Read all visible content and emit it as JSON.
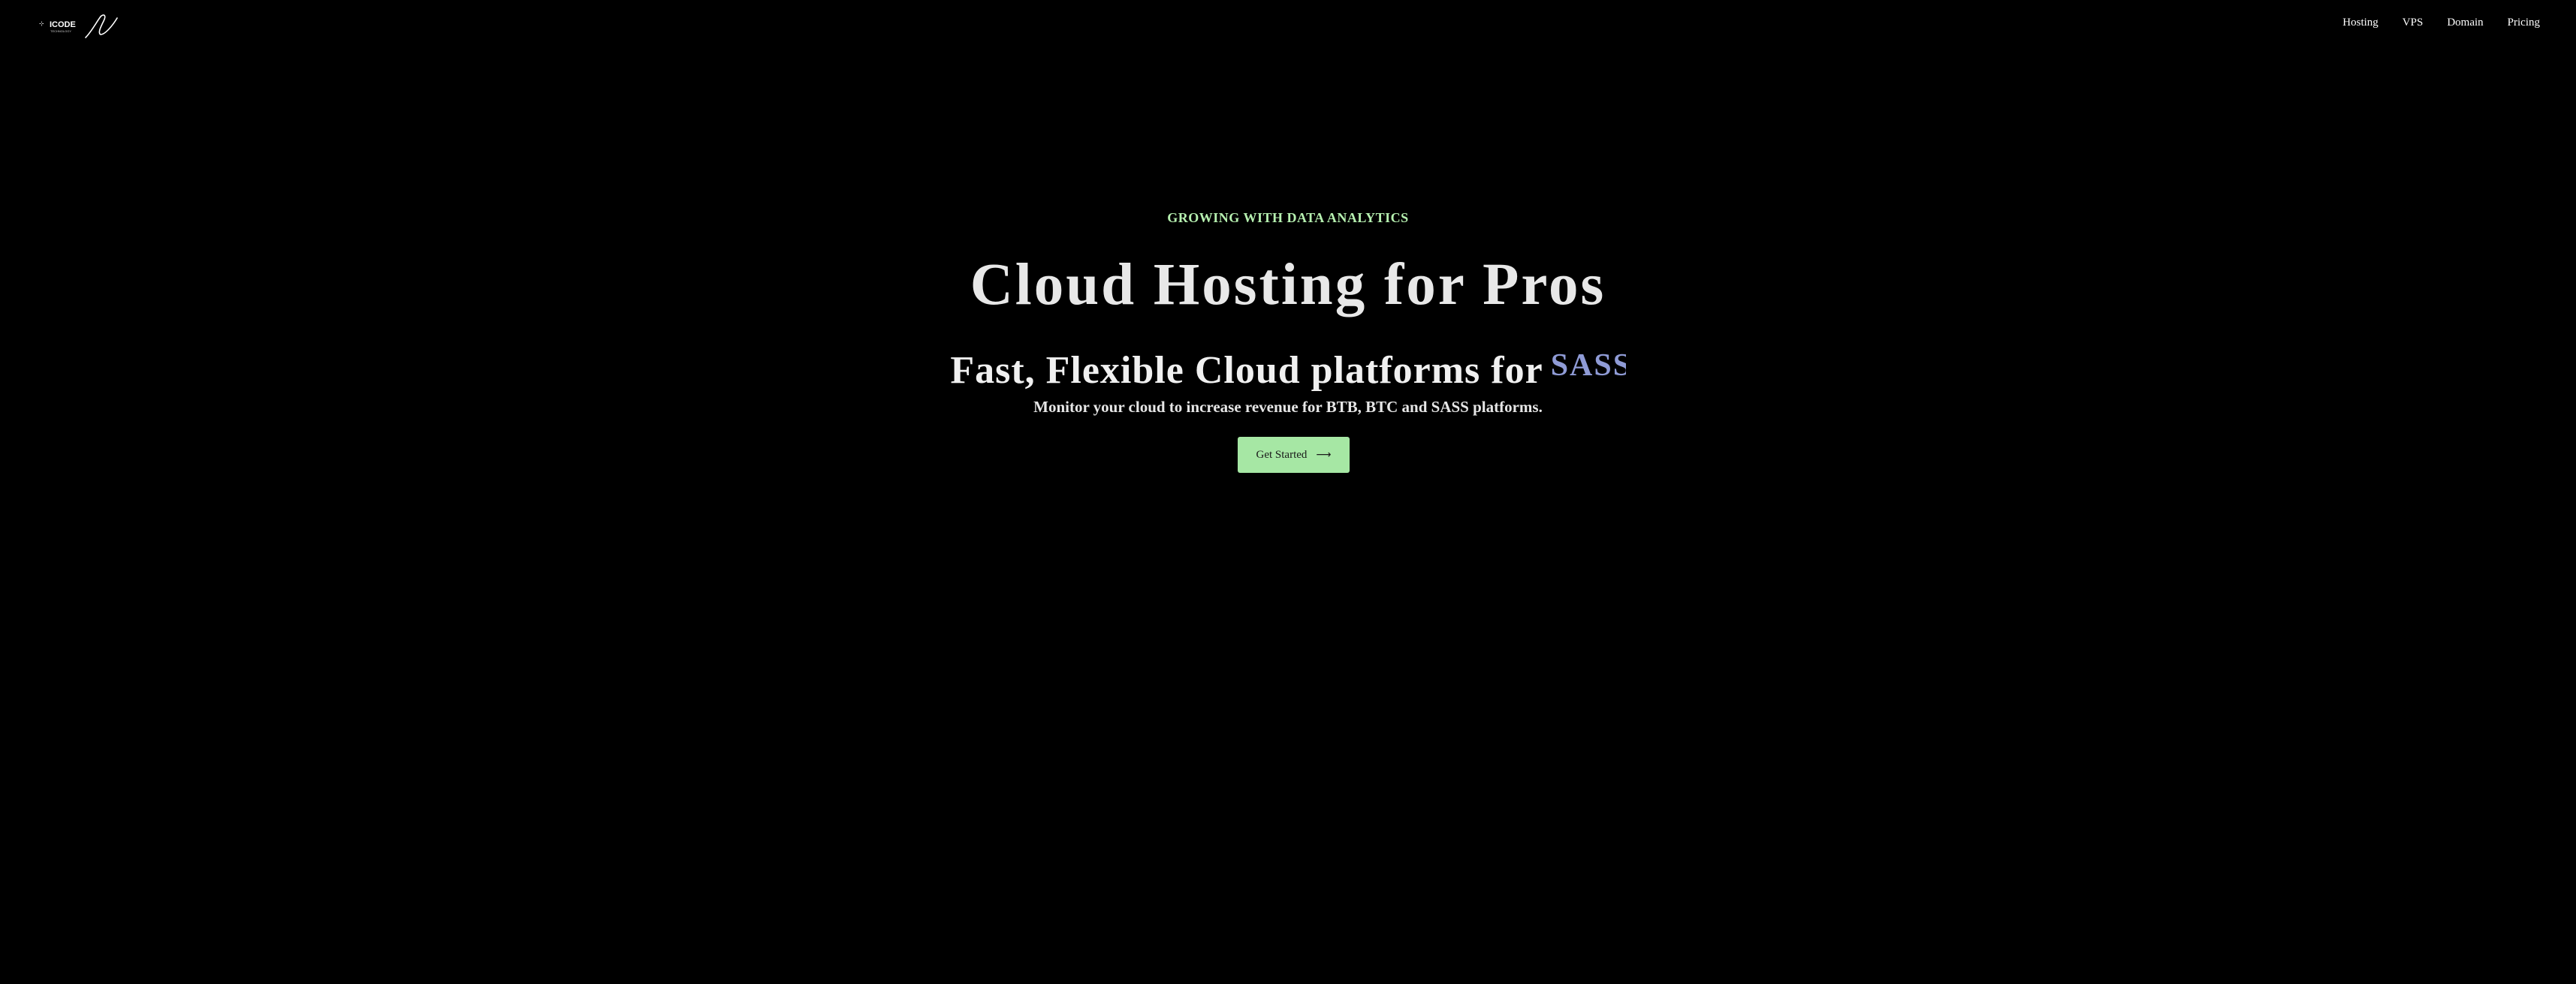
{
  "brand": {
    "logo_text": "ICODE",
    "logo_subtext": "TECHNOLOGY"
  },
  "nav": {
    "items": [
      {
        "label": "Hosting"
      },
      {
        "label": "VPS"
      },
      {
        "label": "Domain"
      },
      {
        "label": "Pricing"
      }
    ]
  },
  "hero": {
    "eyebrow": "GROWING WITH DATA ANALYTICS",
    "title": "Cloud Hosting for Pros",
    "subtitle_prefix": "Fast, Flexible Cloud platforms for",
    "subtitle_typed": "SASS.",
    "description": "Monitor your cloud to increase revenue for BTB, BTC and SASS platforms.",
    "cta_label": "Get Started",
    "cta_icon": "arrow-right-icon"
  },
  "colors": {
    "background": "#000000",
    "accent": "#a6e7a4",
    "eyebrow": "#b6f0b0",
    "typed_text": "#8f9bd6"
  }
}
